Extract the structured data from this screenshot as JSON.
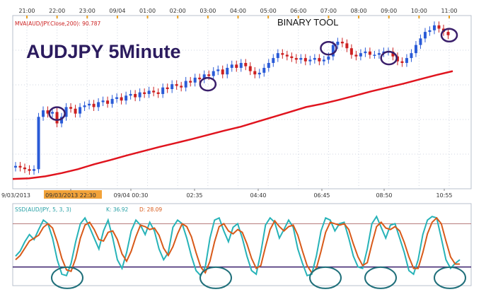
{
  "chart_data": [
    {
      "type": "candlestick",
      "title": "AUDJPY 5Minute",
      "watermark": "BINARY TOOL",
      "indicator_label": "MVA(AUD/JPY.Close,200): 90.787",
      "top_time_ticks": [
        "21:00",
        "22:00",
        "23:00",
        "09/04",
        "01:00",
        "02:00",
        "03:00",
        "04:00",
        "05:00",
        "06:00",
        "07:00",
        "08:00",
        "09:00",
        "10:00",
        "11:00"
      ],
      "bottom_time_ticks": [
        "9/03/2013",
        "09/03/2013 22:30",
        "09/04 00:30",
        "02:35",
        "04:40",
        "06:45",
        "08:50",
        "10:55"
      ],
      "highlighted_tick": "09/03/2013 22:30",
      "price_close": [
        88.1,
        88.05,
        88.0,
        87.95,
        88.0,
        89.6,
        89.8,
        89.7,
        89.75,
        89.4,
        89.6,
        89.9,
        89.85,
        89.7,
        89.9,
        89.95,
        90.0,
        89.9,
        90.05,
        90.1,
        90.0,
        90.15,
        90.2,
        90.1,
        90.25,
        90.3,
        90.2,
        90.35,
        90.3,
        90.4,
        90.35,
        90.3,
        90.5,
        90.45,
        90.6,
        90.55,
        90.5,
        90.7,
        90.65,
        90.8,
        90.75,
        90.9,
        90.85,
        91.0,
        91.05,
        90.9,
        91.1,
        91.2,
        91.1,
        91.25,
        91.15,
        91.0,
        90.9,
        90.95,
        91.1,
        91.25,
        91.4,
        91.55,
        91.5,
        91.45,
        91.4,
        91.35,
        91.4,
        91.3,
        91.35,
        91.4,
        91.3,
        91.35,
        91.45,
        91.8,
        91.9,
        91.85,
        91.7,
        91.5,
        91.45,
        91.55,
        91.6,
        91.5,
        91.5,
        91.55,
        91.6,
        91.6,
        91.45,
        91.3,
        91.25,
        91.4,
        91.55,
        91.8,
        92.0,
        92.2,
        92.25,
        92.4,
        92.3,
        92.2,
        92.1
      ],
      "moving_average": [
        87.7,
        87.72,
        87.78,
        87.88,
        88.0,
        88.15,
        88.28,
        88.42,
        88.55,
        88.68,
        88.8,
        88.92,
        89.05,
        89.18,
        89.3,
        89.45,
        89.6,
        89.75,
        89.9,
        90.0,
        90.12,
        90.25,
        90.38,
        90.5,
        90.62,
        90.75,
        90.88,
        91.0
      ],
      "circled_points": [
        {
          "time_label": "22:00",
          "price": 89.7
        },
        {
          "time_label": "03:00",
          "price": 90.6
        },
        {
          "time_label": "07:00",
          "price": 91.7
        },
        {
          "time_label": "09:00",
          "price": 91.4
        },
        {
          "time_label": "11:00",
          "price": 92.1
        }
      ],
      "colors": {
        "bull": "#2a5bd7",
        "bear": "#cc2020",
        "moving_average": "#e0141e",
        "marker": "#3a1f6b",
        "grid": "#cfd6e0"
      }
    },
    {
      "type": "line",
      "indicator_label": "SSD(AUD/JPY, 5, 3, 3) ",
      "k_label": "K: 36.92",
      "d_label": "D: 28.09",
      "ylim": [
        0,
        100
      ],
      "levels": [
        80,
        20
      ],
      "series": [
        {
          "name": "K",
          "color": "#27b3b8",
          "values": [
            35,
            42,
            55,
            65,
            58,
            72,
            85,
            80,
            60,
            30,
            10,
            8,
            25,
            55,
            80,
            88,
            75,
            60,
            45,
            70,
            85,
            60,
            30,
            18,
            40,
            70,
            85,
            78,
            65,
            82,
            70,
            45,
            30,
            40,
            75,
            85,
            80,
            60,
            35,
            15,
            8,
            20,
            60,
            85,
            88,
            70,
            55,
            75,
            80,
            60,
            35,
            15,
            10,
            40,
            78,
            88,
            82,
            60,
            72,
            85,
            75,
            45,
            25,
            8,
            10,
            35,
            70,
            88,
            85,
            70,
            80,
            82,
            60,
            35,
            20,
            18,
            45,
            80,
            90,
            75,
            60,
            78,
            80,
            60,
            40,
            15,
            10,
            30,
            65,
            85,
            90,
            88,
            60,
            30,
            18,
            25,
            30
          ]
        },
        {
          "name": "D",
          "color": "#d85a1a",
          "values": [
            30,
            36,
            46,
            56,
            60,
            64,
            75,
            80,
            74,
            55,
            32,
            16,
            14,
            32,
            60,
            78,
            82,
            72,
            58,
            56,
            68,
            70,
            58,
            38,
            28,
            42,
            62,
            78,
            76,
            72,
            74,
            64,
            46,
            36,
            48,
            66,
            80,
            76,
            62,
            40,
            20,
            12,
            28,
            55,
            76,
            80,
            70,
            66,
            72,
            68,
            52,
            32,
            18,
            22,
            48,
            72,
            84,
            76,
            70,
            76,
            78,
            64,
            42,
            22,
            12,
            18,
            42,
            68,
            82,
            80,
            78,
            80,
            72,
            52,
            34,
            22,
            26,
            52,
            76,
            82,
            74,
            72,
            76,
            70,
            54,
            34,
            18,
            18,
            40,
            66,
            82,
            88,
            80,
            56,
            34,
            24,
            24
          ]
        }
      ],
      "circled_points": [
        {
          "time_label": "22:30",
          "value": 5
        },
        {
          "time_label": "02:35",
          "value": 5
        },
        {
          "time_label": "06:45",
          "value": 5
        },
        {
          "time_label": "08:50",
          "value": 5
        },
        {
          "time_label": "10:55",
          "value": 5
        }
      ]
    }
  ]
}
